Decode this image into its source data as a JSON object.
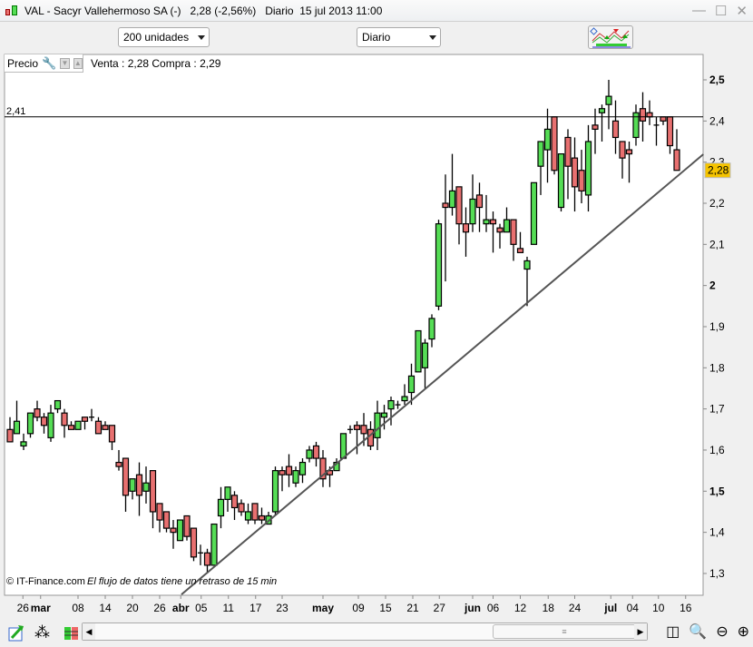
{
  "window": {
    "title": "VAL - Sacyr Vallehermoso SA (-)   2,28 (-2,56%)   Diario  15 jul 2013 11:00",
    "controls": [
      "minimize",
      "maximize",
      "close"
    ]
  },
  "toolbar": {
    "units_select": "200 unidades",
    "period_select": "Diario",
    "indicators_button": "indicators-icon"
  },
  "chart_header": {
    "label": "Precio",
    "quote": "Venta : 2,28 Compra : 2,29"
  },
  "footer": {
    "copyright": "© IT-Finance.com",
    "delay_notice": "El flujo de datos tiene un retraso de 15 min"
  },
  "colors": {
    "up": "#55dd55",
    "down": "#e87070",
    "last_price_bg": "#f5c400",
    "line": "#000000"
  },
  "chart_data": {
    "type": "candlestick",
    "symbol": "VAL",
    "last_price_label": "2,28",
    "hline": {
      "value": 2.41,
      "label": "2,41"
    },
    "trendline": {
      "from": [
        25.2,
        1.249
      ],
      "to": [
        101.9,
        2.319
      ]
    },
    "ylim": [
      1.25,
      2.56
    ],
    "yticks": [
      {
        "v": 2.5,
        "label": "2,5",
        "bold": true
      },
      {
        "v": 2.4,
        "label": "2,4"
      },
      {
        "v": 2.3,
        "label": "2,3"
      },
      {
        "v": 2.2,
        "label": "2,2"
      },
      {
        "v": 2.1,
        "label": "2,1"
      },
      {
        "v": 2.0,
        "label": "2",
        "bold": true
      },
      {
        "v": 1.9,
        "label": "1,9"
      },
      {
        "v": 1.8,
        "label": "1,8"
      },
      {
        "v": 1.7,
        "label": "1,7"
      },
      {
        "v": 1.6,
        "label": "1,6"
      },
      {
        "v": 1.5,
        "label": "1,5",
        "bold": true
      },
      {
        "v": 1.4,
        "label": "1,4"
      },
      {
        "v": 1.3,
        "label": "1,3"
      }
    ],
    "xticks": [
      {
        "i": 1.9,
        "label": "26"
      },
      {
        "i": 4.5,
        "label": "mar",
        "bold": true
      },
      {
        "i": 10,
        "label": "08"
      },
      {
        "i": 14,
        "label": "14"
      },
      {
        "i": 18,
        "label": "20"
      },
      {
        "i": 22,
        "label": "26"
      },
      {
        "i": 25.1,
        "label": "abr",
        "bold": true
      },
      {
        "i": 28.1,
        "label": "05"
      },
      {
        "i": 32.1,
        "label": "11"
      },
      {
        "i": 36.1,
        "label": "17"
      },
      {
        "i": 40,
        "label": "23"
      },
      {
        "i": 46,
        "label": "may",
        "bold": true
      },
      {
        "i": 51.2,
        "label": "09"
      },
      {
        "i": 55.2,
        "label": "15"
      },
      {
        "i": 59.2,
        "label": "21"
      },
      {
        "i": 63.1,
        "label": "27"
      },
      {
        "i": 68,
        "label": "jun",
        "bold": true
      },
      {
        "i": 71,
        "label": "06"
      },
      {
        "i": 75,
        "label": "12"
      },
      {
        "i": 79.1,
        "label": "18"
      },
      {
        "i": 83,
        "label": "24"
      },
      {
        "i": 88.3,
        "label": "jul",
        "bold": true
      },
      {
        "i": 91.5,
        "label": "04"
      },
      {
        "i": 95.3,
        "label": "10"
      },
      {
        "i": 99.3,
        "label": "16"
      }
    ],
    "ohlc": [
      [
        1.65,
        1.68,
        1.62,
        1.62
      ],
      [
        1.64,
        1.72,
        1.64,
        1.67
      ],
      [
        1.61,
        1.64,
        1.6,
        1.62
      ],
      [
        1.64,
        1.69,
        1.63,
        1.69
      ],
      [
        1.7,
        1.72,
        1.67,
        1.68
      ],
      [
        1.68,
        1.69,
        1.64,
        1.66
      ],
      [
        1.63,
        1.71,
        1.62,
        1.69
      ],
      [
        1.7,
        1.72,
        1.69,
        1.72
      ],
      [
        1.69,
        1.7,
        1.63,
        1.66
      ],
      [
        1.66,
        1.67,
        1.65,
        1.65
      ],
      [
        1.65,
        1.67,
        1.65,
        1.67
      ],
      [
        1.68,
        1.68,
        1.65,
        1.67
      ],
      [
        1.68,
        1.7,
        1.67,
        1.68
      ],
      [
        1.67,
        1.68,
        1.64,
        1.64
      ],
      [
        1.66,
        1.67,
        1.65,
        1.65
      ],
      [
        1.66,
        1.66,
        1.6,
        1.62
      ],
      [
        1.57,
        1.6,
        1.55,
        1.56
      ],
      [
        1.58,
        1.58,
        1.45,
        1.49
      ],
      [
        1.5,
        1.53,
        1.48,
        1.53
      ],
      [
        1.54,
        1.57,
        1.44,
        1.49
      ],
      [
        1.5,
        1.56,
        1.47,
        1.52
      ],
      [
        1.55,
        1.55,
        1.41,
        1.45
      ],
      [
        1.47,
        1.47,
        1.4,
        1.43
      ],
      [
        1.45,
        1.45,
        1.4,
        1.41
      ],
      [
        1.41,
        1.43,
        1.36,
        1.4
      ],
      [
        1.38,
        1.43,
        1.38,
        1.43
      ],
      [
        1.44,
        1.44,
        1.38,
        1.39
      ],
      [
        1.41,
        1.41,
        1.33,
        1.34
      ],
      [
        1.35,
        1.37,
        1.32,
        1.35
      ],
      [
        1.35,
        1.36,
        1.3,
        1.32
      ],
      [
        1.32,
        1.42,
        1.32,
        1.42
      ],
      [
        1.44,
        1.51,
        1.41,
        1.48
      ],
      [
        1.48,
        1.51,
        1.45,
        1.51
      ],
      [
        1.49,
        1.5,
        1.43,
        1.46
      ],
      [
        1.47,
        1.48,
        1.44,
        1.45
      ],
      [
        1.43,
        1.47,
        1.42,
        1.45
      ],
      [
        1.47,
        1.47,
        1.42,
        1.43
      ],
      [
        1.44,
        1.46,
        1.42,
        1.43
      ],
      [
        1.42,
        1.45,
        1.42,
        1.44
      ],
      [
        1.45,
        1.56,
        1.44,
        1.55
      ],
      [
        1.55,
        1.56,
        1.5,
        1.54
      ],
      [
        1.56,
        1.59,
        1.51,
        1.54
      ],
      [
        1.52,
        1.56,
        1.51,
        1.55
      ],
      [
        1.54,
        1.58,
        1.52,
        1.57
      ],
      [
        1.58,
        1.61,
        1.57,
        1.6
      ],
      [
        1.61,
        1.62,
        1.56,
        1.58
      ],
      [
        1.58,
        1.6,
        1.51,
        1.53
      ],
      [
        1.55,
        1.56,
        1.51,
        1.54
      ],
      [
        1.55,
        1.58,
        1.55,
        1.57
      ],
      [
        1.58,
        1.64,
        1.58,
        1.64
      ],
      [
        1.65,
        1.66,
        1.64,
        1.65
      ],
      [
        1.66,
        1.67,
        1.59,
        1.65
      ],
      [
        1.66,
        1.69,
        1.61,
        1.64
      ],
      [
        1.65,
        1.67,
        1.6,
        1.61
      ],
      [
        1.63,
        1.72,
        1.6,
        1.69
      ],
      [
        1.68,
        1.71,
        1.65,
        1.69
      ],
      [
        1.7,
        1.73,
        1.66,
        1.72
      ],
      [
        1.71,
        1.72,
        1.7,
        1.71
      ],
      [
        1.72,
        1.76,
        1.71,
        1.73
      ],
      [
        1.74,
        1.81,
        1.71,
        1.78
      ],
      [
        1.79,
        1.89,
        1.79,
        1.89
      ],
      [
        1.8,
        1.87,
        1.75,
        1.86
      ],
      [
        1.87,
        1.93,
        1.85,
        1.92
      ],
      [
        1.95,
        2.16,
        1.94,
        2.15
      ],
      [
        2.2,
        2.27,
        2.01,
        2.19
      ],
      [
        2.19,
        2.32,
        2.17,
        2.23
      ],
      [
        2.24,
        2.24,
        2.1,
        2.15
      ],
      [
        2.15,
        2.19,
        2.07,
        2.13
      ],
      [
        2.15,
        2.27,
        2.13,
        2.21
      ],
      [
        2.22,
        2.25,
        2.13,
        2.19
      ],
      [
        2.15,
        2.22,
        2.13,
        2.16
      ],
      [
        2.16,
        2.18,
        2.08,
        2.15
      ],
      [
        2.14,
        2.15,
        2.09,
        2.13
      ],
      [
        2.13,
        2.19,
        2.13,
        2.16
      ],
      [
        2.16,
        2.16,
        2.06,
        2.1
      ],
      [
        2.09,
        2.13,
        2.08,
        2.08
      ],
      [
        2.04,
        2.07,
        1.95,
        2.06
      ],
      [
        2.1,
        2.25,
        2.1,
        2.25
      ],
      [
        2.29,
        2.34,
        2.22,
        2.35
      ],
      [
        2.33,
        2.43,
        2.25,
        2.38
      ],
      [
        2.41,
        2.41,
        2.27,
        2.28
      ],
      [
        2.19,
        2.32,
        2.18,
        2.32
      ],
      [
        2.36,
        2.38,
        2.21,
        2.29
      ],
      [
        2.31,
        2.36,
        2.18,
        2.24
      ],
      [
        2.28,
        2.33,
        2.2,
        2.23
      ],
      [
        2.22,
        2.39,
        2.18,
        2.35
      ],
      [
        2.39,
        2.43,
        2.32,
        2.38
      ],
      [
        2.42,
        2.44,
        2.35,
        2.43
      ],
      [
        2.44,
        2.5,
        2.38,
        2.46
      ],
      [
        2.4,
        2.45,
        2.32,
        2.36
      ],
      [
        2.35,
        2.35,
        2.26,
        2.31
      ],
      [
        2.33,
        2.35,
        2.25,
        2.32
      ],
      [
        2.36,
        2.44,
        2.34,
        2.42
      ],
      [
        2.43,
        2.47,
        2.35,
        2.4
      ],
      [
        2.42,
        2.45,
        2.39,
        2.41
      ],
      [
        2.39,
        2.41,
        2.34,
        2.39
      ],
      [
        2.41,
        2.41,
        2.39,
        2.4
      ],
      [
        2.41,
        2.41,
        2.32,
        2.34
      ],
      [
        2.33,
        2.38,
        2.28,
        2.28
      ]
    ]
  }
}
